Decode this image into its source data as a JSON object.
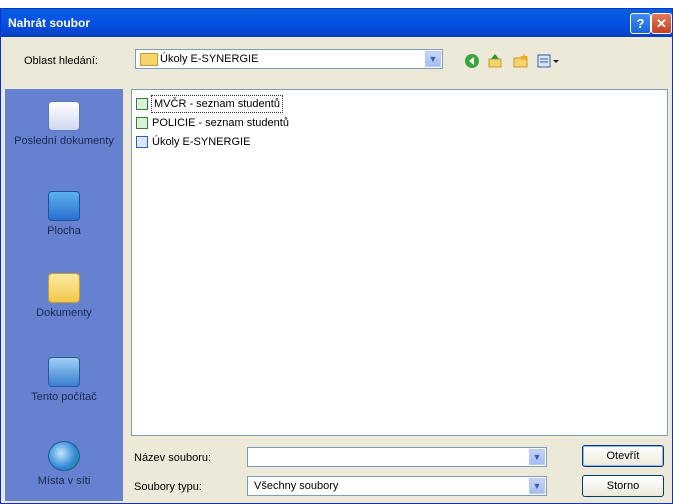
{
  "window": {
    "title": "Nahrát soubor",
    "help_glyph": "?",
    "close_glyph": "✕"
  },
  "lookin": {
    "label": "Oblast hledání:",
    "value": "Úkoly E-SYNERGIE"
  },
  "places": [
    {
      "label": "Poslední dokumenty",
      "icon": "recent-documents-icon"
    },
    {
      "label": "Plocha",
      "icon": "desktop-icon"
    },
    {
      "label": "Dokumenty",
      "icon": "documents-icon"
    },
    {
      "label": "Tento počítač",
      "icon": "computer-icon"
    },
    {
      "label": "Místa v síti",
      "icon": "network-icon"
    }
  ],
  "files": [
    {
      "name": "MVČR - seznam studentů",
      "icon": "excel-file-icon"
    },
    {
      "name": "POLICIE - seznam studentů",
      "icon": "excel-file-icon"
    },
    {
      "name": "Úkoly E-SYNERGIE",
      "icon": "word-file-icon"
    }
  ],
  "filename": {
    "label": "Název souboru:",
    "value": ""
  },
  "filetype": {
    "label": "Soubory typu:",
    "value": "Všechny soubory"
  },
  "buttons": {
    "open": "Otevřít",
    "cancel": "Storno"
  },
  "colors": {
    "titlebar": "#0454e6",
    "places_bar": "#6681cf",
    "dialog_bg": "#ece9d8"
  }
}
